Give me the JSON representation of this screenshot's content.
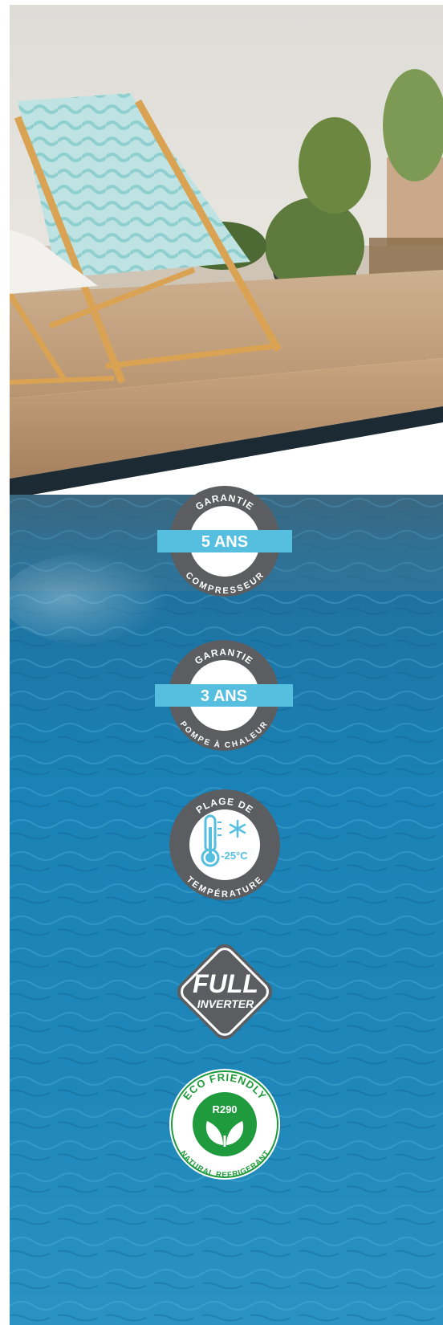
{
  "badges": {
    "compressor_warranty": {
      "top_arc": "GARANTIE",
      "ribbon": "5 ANS",
      "bottom_arc": "COMPRESSEUR"
    },
    "heat_pump_warranty": {
      "top_arc": "GARANTIE",
      "ribbon": "3 ANS",
      "bottom_arc": "POMPE À CHALEUR"
    },
    "temperature_range": {
      "top_arc": "PLAGE DE",
      "value": "-25°C",
      "bottom_arc": "TEMPÉRATURE",
      "icons": [
        "thermometer-icon",
        "snowflake-icon"
      ]
    },
    "full_inverter": {
      "line1": "FULL",
      "line2": "INVERTER"
    },
    "eco_friendly": {
      "top_arc": "ECO FRIENDLY",
      "center": "R290",
      "bottom_arc": "NATURAL REFRIGERANT",
      "icon": "leaf-icon"
    }
  },
  "colors": {
    "badge_gray": "#5b5d60",
    "ribbon_blue": "#56bfe0",
    "eco_green": "#1f9a3c",
    "pool_blue": "#1e7fb0",
    "deck_wood": "#c8a47c",
    "wall": "#e3e1dc"
  }
}
